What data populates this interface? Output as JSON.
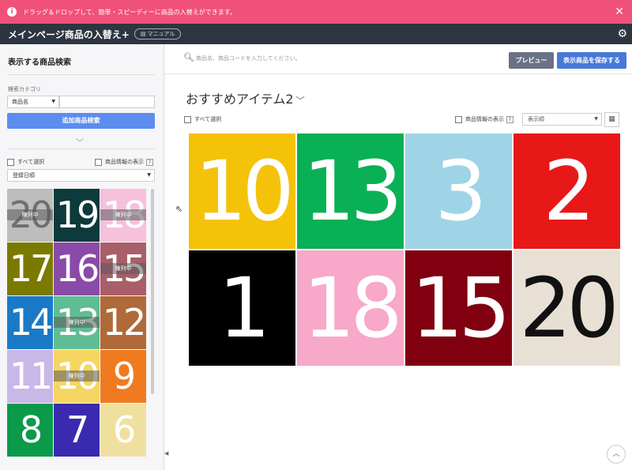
{
  "banner": {
    "icon": "info-icon",
    "message": "ドラッグ＆ドロップして、簡単・スピーディーに商品の入替えができます。",
    "close": "✕"
  },
  "topbar": {
    "title": "メインページ商品の入替え+",
    "manual": "マニュアル",
    "settings_icon": "gear-icon"
  },
  "sidebar": {
    "title": "表示する商品検索",
    "category_label": "検索カテゴリ",
    "field_select": "商品名",
    "search_button": "追加商品検索",
    "select_all": "すべて選択",
    "show_info": "商品情報の表示",
    "help": "?",
    "sort_select": "登録日順",
    "tiles": [
      {
        "number": "20",
        "color": "#9a9a9a",
        "text_color": "#222",
        "arranged": true
      },
      {
        "number": "19",
        "color": "#0d3a3a",
        "text_color": "#fff",
        "arranged": false
      },
      {
        "number": "18",
        "color": "#f0a0c8",
        "text_color": "#fff",
        "arranged": true
      },
      {
        "number": "17",
        "color": "#7a7a00",
        "text_color": "#fff",
        "arranged": false
      },
      {
        "number": "16",
        "color": "#8a4aa8",
        "text_color": "#fff",
        "arranged": false
      },
      {
        "number": "15",
        "color": "#7a0a1a",
        "text_color": "#fff",
        "arranged": true
      },
      {
        "number": "14",
        "color": "#1a7ac8",
        "text_color": "#fff",
        "arranged": false
      },
      {
        "number": "13",
        "color": "#0a9a5a",
        "text_color": "#fff",
        "arranged": true
      },
      {
        "number": "12",
        "color": "#b06a3a",
        "text_color": "#fff",
        "arranged": false
      },
      {
        "number": "11",
        "color": "#c8b8e8",
        "text_color": "#fff",
        "arranged": false
      },
      {
        "number": "10",
        "color": "#f0c010",
        "text_color": "#fff",
        "arranged": true
      },
      {
        "number": "9",
        "color": "#f07a20",
        "text_color": "#fff",
        "arranged": false
      },
      {
        "number": "8",
        "color": "#0a9a4a",
        "text_color": "#fff",
        "arranged": false
      },
      {
        "number": "7",
        "color": "#3a2ab0",
        "text_color": "#fff",
        "arranged": false
      },
      {
        "number": "6",
        "color": "#f0e0a0",
        "text_color": "#fff",
        "arranged": false
      }
    ],
    "arranged_label": "陳列中"
  },
  "main": {
    "search_placeholder": "商品名、商品コードを入力してください。",
    "preview_button": "プレビュー",
    "save_button": "表示商品を保存する",
    "section_title": "おすすめアイテム2",
    "select_all": "すべて選択",
    "show_info": "商品情報の表示",
    "help": "?",
    "sort_select": "表示順",
    "tiles": [
      {
        "number": "10",
        "color": "#f5c20a",
        "text_color": "#fff"
      },
      {
        "number": "13",
        "color": "#0ab055",
        "text_color": "#fff"
      },
      {
        "number": "3",
        "color": "#9ed4e6",
        "text_color": "#fff"
      },
      {
        "number": "2",
        "color": "#e81818",
        "text_color": "#fff"
      },
      {
        "number": "1",
        "color": "#000000",
        "text_color": "#fff"
      },
      {
        "number": "18",
        "color": "#f8a8c8",
        "text_color": "#fff"
      },
      {
        "number": "15",
        "color": "#800010",
        "text_color": "#fff"
      },
      {
        "number": "20",
        "color": "#e8e0d4",
        "text_color": "#111"
      }
    ]
  }
}
